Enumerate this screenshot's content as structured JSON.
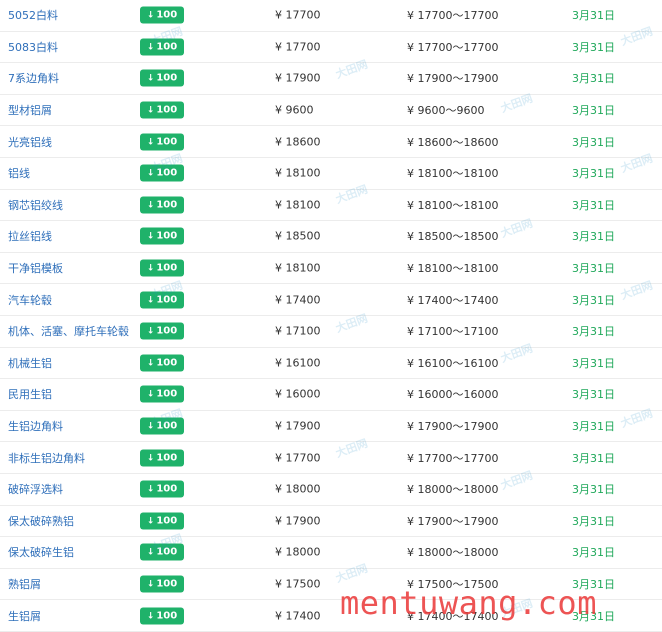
{
  "table": {
    "rows": [
      {
        "name": "5052白料",
        "change": "100",
        "price": "¥ 17700",
        "range": "¥ 17700～17700",
        "date": "3月31日"
      },
      {
        "name": "5083白料",
        "change": "100",
        "price": "¥ 17700",
        "range": "¥ 17700～17700",
        "date": "3月31日"
      },
      {
        "name": "7系边角料",
        "change": "100",
        "price": "¥ 17900",
        "range": "¥ 17900～17900",
        "date": "3月31日"
      },
      {
        "name": "型材铝屑",
        "change": "100",
        "price": "¥ 9600",
        "range": "¥ 9600～9600",
        "date": "3月31日"
      },
      {
        "name": "光亮铝线",
        "change": "100",
        "price": "¥ 18600",
        "range": "¥ 18600～18600",
        "date": "3月31日"
      },
      {
        "name": "铝线",
        "change": "100",
        "price": "¥ 18100",
        "range": "¥ 18100～18100",
        "date": "3月31日"
      },
      {
        "name": "钢芯铝绞线",
        "change": "100",
        "price": "¥ 18100",
        "range": "¥ 18100～18100",
        "date": "3月31日"
      },
      {
        "name": "拉丝铝线",
        "change": "100",
        "price": "¥ 18500",
        "range": "¥ 18500～18500",
        "date": "3月31日"
      },
      {
        "name": "干净铝模板",
        "change": "100",
        "price": "¥ 18100",
        "range": "¥ 18100～18100",
        "date": "3月31日"
      },
      {
        "name": "汽车轮毂",
        "change": "100",
        "price": "¥ 17400",
        "range": "¥ 17400～17400",
        "date": "3月31日"
      },
      {
        "name": "机体、活塞、摩托车轮毂",
        "change": "100",
        "price": "¥ 17100",
        "range": "¥ 17100～17100",
        "date": "3月31日"
      },
      {
        "name": "机械生铝",
        "change": "100",
        "price": "¥ 16100",
        "range": "¥ 16100～16100",
        "date": "3月31日"
      },
      {
        "name": "民用生铝",
        "change": "100",
        "price": "¥ 16000",
        "range": "¥ 16000～16000",
        "date": "3月31日"
      },
      {
        "name": "生铝边角料",
        "change": "100",
        "price": "¥ 17900",
        "range": "¥ 17900～17900",
        "date": "3月31日"
      },
      {
        "name": "非标生铝边角料",
        "change": "100",
        "price": "¥ 17700",
        "range": "¥ 17700～17700",
        "date": "3月31日"
      },
      {
        "name": "破碎浮选料",
        "change": "100",
        "price": "¥ 18000",
        "range": "¥ 18000～18000",
        "date": "3月31日"
      },
      {
        "name": "保太破碎熟铝",
        "change": "100",
        "price": "¥ 17900",
        "range": "¥ 17900～17900",
        "date": "3月31日"
      },
      {
        "name": "保太破碎生铝",
        "change": "100",
        "price": "¥ 18000",
        "range": "¥ 18000～18000",
        "date": "3月31日"
      },
      {
        "name": "熟铝屑",
        "change": "100",
        "price": "¥ 17500",
        "range": "¥ 17500～17500",
        "date": "3月31日"
      },
      {
        "name": "生铝屑",
        "change": "100",
        "price": "¥ 17400",
        "range": "¥ 17400～17400",
        "date": "3月31日"
      }
    ]
  },
  "watermark": {
    "site_text": "mentuwang.com",
    "logo_text": "大田网"
  },
  "colors": {
    "link": "#2f6fba",
    "badge": "#1fb26a",
    "date": "#1fa85a"
  },
  "icons": {
    "change_arrow": "arrow-down-icon"
  }
}
